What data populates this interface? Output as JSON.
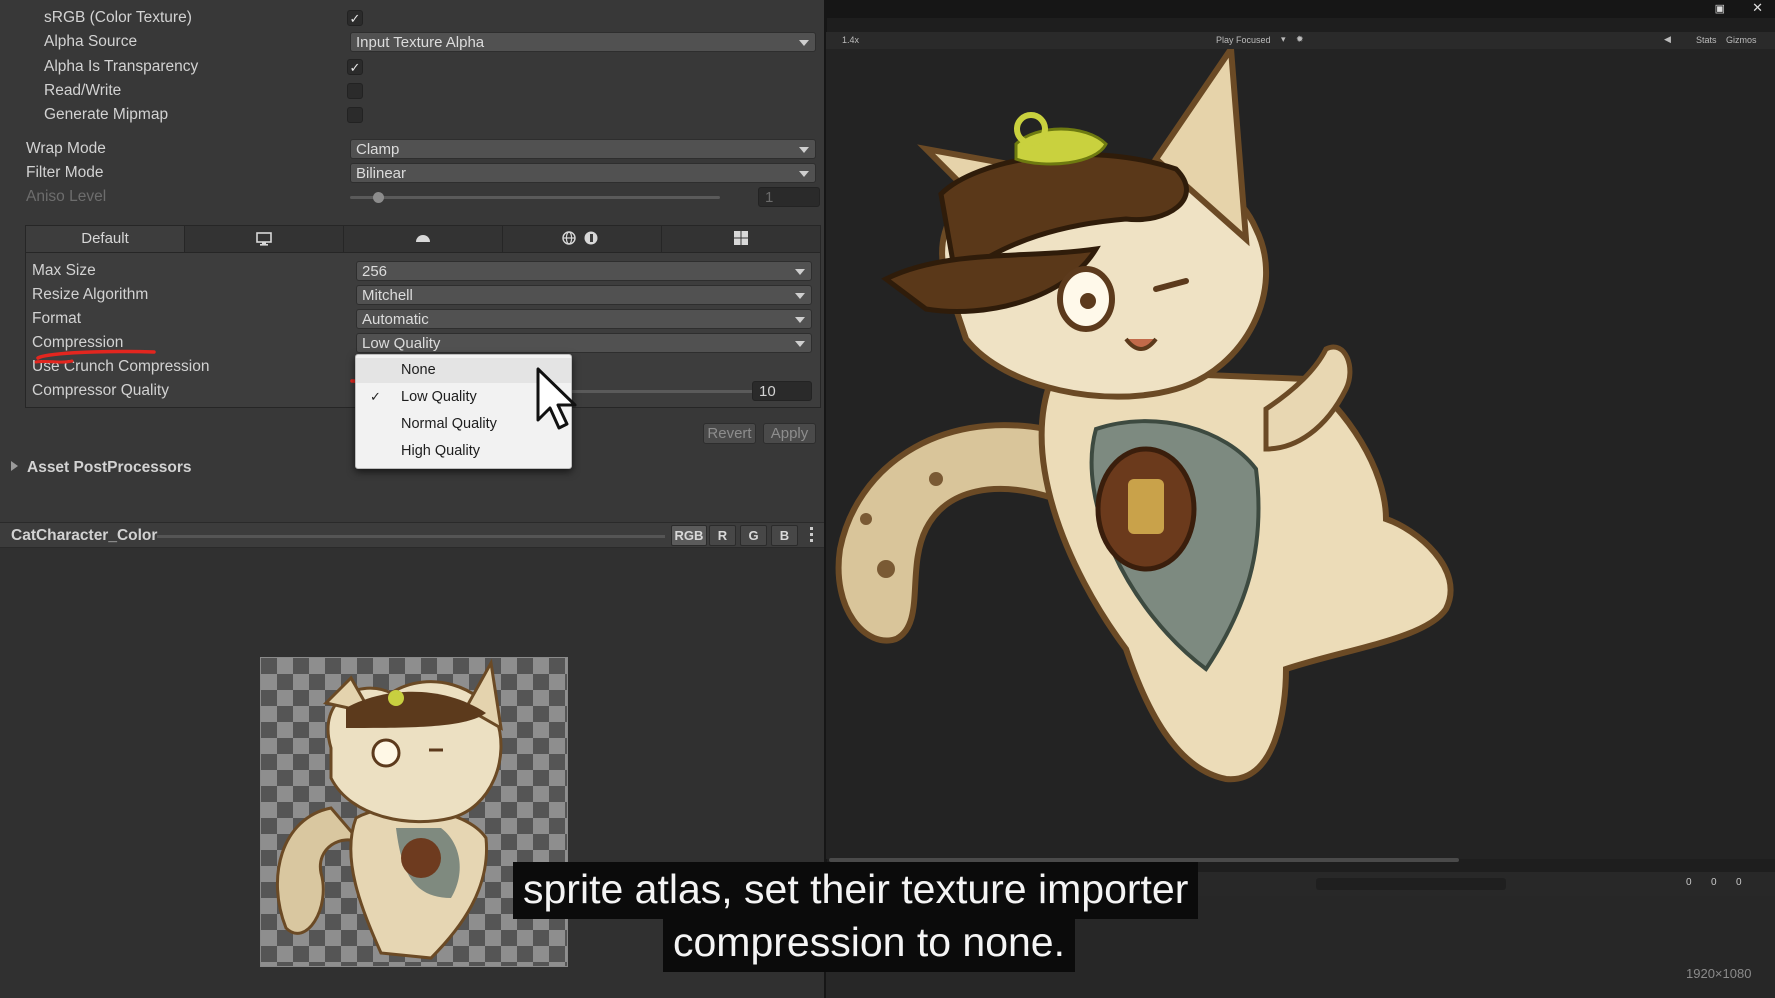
{
  "inspector": {
    "srgb": {
      "label": "sRGB (Color Texture)",
      "checked": true
    },
    "alpha_source": {
      "label": "Alpha Source",
      "value": "Input Texture Alpha"
    },
    "alpha_transparency": {
      "label": "Alpha Is Transparency",
      "checked": true
    },
    "read_write": {
      "label": "Read/Write",
      "checked": false
    },
    "generate_mipmap": {
      "label": "Generate Mipmap",
      "checked": false
    },
    "wrap_mode": {
      "label": "Wrap Mode",
      "value": "Clamp"
    },
    "filter_mode": {
      "label": "Filter Mode",
      "value": "Bilinear"
    },
    "aniso_level": {
      "label": "Aniso Level",
      "value": "1"
    },
    "platform_tabs": [
      {
        "label": "Default",
        "icon": "default"
      },
      {
        "label": "",
        "icon": "monitor-icon"
      },
      {
        "label": "",
        "icon": "android-icon"
      },
      {
        "label": "",
        "icon": "webgl-icon"
      },
      {
        "label": "",
        "icon": "windows-store-icon"
      }
    ],
    "max_size": {
      "label": "Max Size",
      "value": "256"
    },
    "resize_algorithm": {
      "label": "Resize Algorithm",
      "value": "Mitchell"
    },
    "format": {
      "label": "Format",
      "value": "Automatic"
    },
    "compression": {
      "label": "Compression",
      "value": "Low Quality"
    },
    "crunch": {
      "label": "Use Crunch Compression"
    },
    "compressor_quality": {
      "label": "Compressor Quality",
      "value": "10"
    },
    "revert_label": "Revert",
    "apply_label": "Apply",
    "postprocessors_label": "Asset PostProcessors"
  },
  "compression_popup": {
    "options": [
      "None",
      "Low Quality",
      "Normal Quality",
      "High Quality"
    ],
    "selected": "Low Quality",
    "hovered": "None"
  },
  "preview": {
    "title": "CatCharacter_Color",
    "channels": [
      "RGB",
      "R",
      "G",
      "B"
    ],
    "active_channel": "RGB"
  },
  "game_view": {
    "scale": "1.4x",
    "play_mode": "Play Focused",
    "stats_label": "Stats",
    "gizmos_label": "Gizmos",
    "resolution": "1920×1080",
    "console_counts": {
      "info": "0",
      "warn": "0",
      "error": "0"
    }
  },
  "caption": {
    "line1": "sprite atlas, set their texture importer",
    "line2": "compression to none."
  },
  "colors": {
    "annotation_red": "#e3261f",
    "panel_bg": "#383838"
  }
}
